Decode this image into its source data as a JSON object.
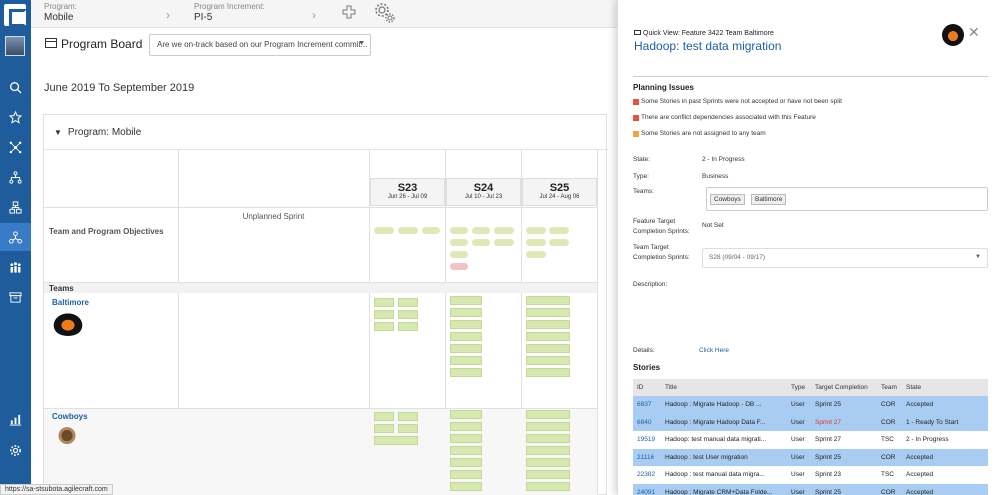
{
  "topbar": {
    "program_label": "Program:",
    "program_value": "Mobile",
    "pi_label": "Program Increment:",
    "pi_value": "PI-5"
  },
  "sidebar": {
    "icons": [
      "search-icon",
      "star-icon",
      "network-icon",
      "hierarchy-icon",
      "org-chart-icon",
      "team-icon",
      "people-icon",
      "archive-icon",
      "chart-icon",
      "settings-icon"
    ]
  },
  "board": {
    "title": "Program Board",
    "query": "Are we on-track based on our Program Increment commit...",
    "date_range": "June 2019 To September 2019",
    "program_header": "Program: Mobile",
    "unplanned_label": "Unplanned Sprint",
    "objectives_label": "Team and Program Objectives",
    "teams_label": "Teams",
    "sprints": [
      {
        "name": "S23",
        "dates": "Jun 26 - Jul 09"
      },
      {
        "name": "S24",
        "dates": "Jul 10 - Jul 23"
      },
      {
        "name": "S25",
        "dates": "Jul 24 - Aug 06"
      }
    ],
    "teams": [
      {
        "name": "Baltimore"
      },
      {
        "name": "Cowboys"
      }
    ]
  },
  "status_url": "https://sa-stsubota.agilecraft.com",
  "quick_view": {
    "subtitle": "Quick View: Feature 3422 Team Baltimore",
    "title": "Hadoop: test data migration",
    "planning_issues_heading": "Planning Issues",
    "issues": [
      {
        "text": "Some Stories in past Sprints were not accepted or have not been split",
        "color": "#e8513f"
      },
      {
        "text": "There are conflict dependencies associated with this Feature",
        "color": "#e8513f"
      },
      {
        "text": "Some Stories are not assigned to any team",
        "color": "#f4a340"
      }
    ],
    "state_label": "State:",
    "state_value": "2 - In Progress",
    "type_label": "Type:",
    "type_value": "Business",
    "teams_label": "Teams:",
    "team_tags": [
      "Cowboys",
      "Baltimore"
    ],
    "ftc_label_1": "Feature Target",
    "ftc_label_2": "Completion Sprints:",
    "ftc_value": "Not Set",
    "ttc_label_1": "Team Target",
    "ttc_label_2": "Completion Sprints:",
    "ttc_value": "S28 (09/04 - 09/17)",
    "description_label": "Description:",
    "details_label": "Details:",
    "details_link": "Click Here",
    "stories_heading": "Stories",
    "stories_columns": [
      "ID",
      "Title",
      "Type",
      "Target Completion",
      "Team",
      "State"
    ],
    "stories": [
      {
        "id": "6837",
        "title": "Hadoop : Migrate Hadoop - DB ...",
        "type": "User",
        "target": "Sprint 25",
        "team": "COR",
        "state": "Accepted",
        "highlight": true,
        "late": false
      },
      {
        "id": "6840",
        "title": "Hadoop : Migrate Hadoop Data F...",
        "type": "User",
        "target": "Sprint 27",
        "team": "COR",
        "state": "1 - Ready To Start",
        "highlight": true,
        "late": true
      },
      {
        "id": "19519",
        "title": "Hadoop: test manual data migrati...",
        "type": "User",
        "target": "Sprint 27",
        "team": "TSC",
        "state": "2 - In Progress",
        "highlight": false,
        "late": false
      },
      {
        "id": "21116",
        "title": "Hadoop : test User migration",
        "type": "User",
        "target": "Sprint 25",
        "team": "COR",
        "state": "Accepted",
        "highlight": true,
        "late": false
      },
      {
        "id": "22382",
        "title": "Hadoop : test manual data migra...",
        "type": "User",
        "target": "Sprint 23",
        "team": "TSC",
        "state": "Accepted",
        "highlight": false,
        "late": false
      },
      {
        "id": "24091",
        "title": "Hadoop : Migrate CRM+Data Folde...",
        "type": "User",
        "target": "Sprint 25",
        "team": "COR",
        "state": "Accepted",
        "highlight": true,
        "late": false
      }
    ]
  }
}
